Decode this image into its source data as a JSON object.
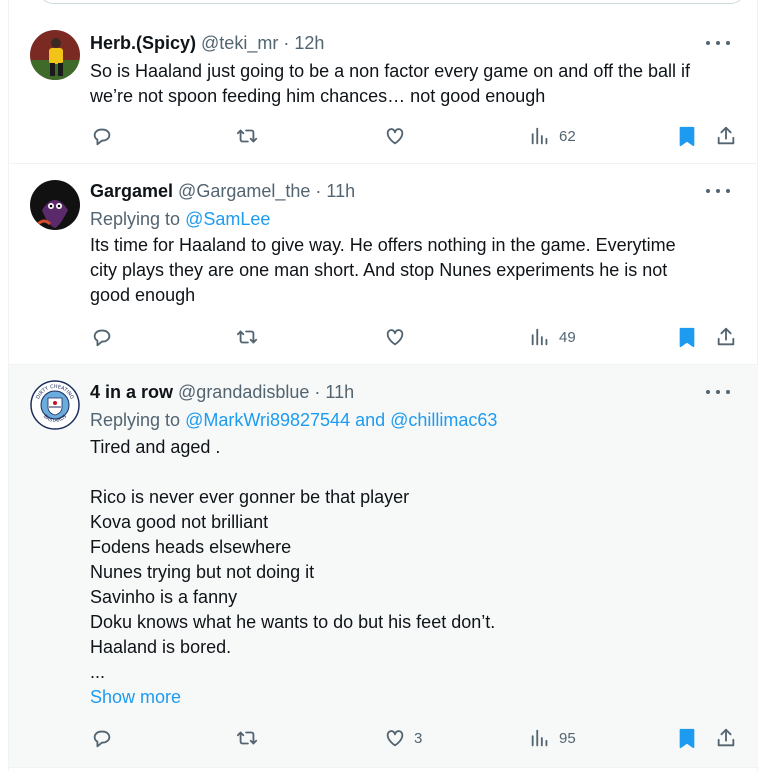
{
  "tweets": [
    {
      "name": "Herb.(Spicy)",
      "handle": "@teki_mr",
      "dot": "·",
      "time": "12h",
      "text_lines": [
        "So is Haaland just going to be a non factor every game on and off the ball if",
        "we’re not spoon feeding him chances… not good enough"
      ],
      "likes": "",
      "views": "62"
    },
    {
      "name": "Gargamel",
      "handle": "@Gargamel_the",
      "dot": "·",
      "time": "11h",
      "replying_prefix": "Replying to ",
      "replying_to": "@SamLee",
      "text_lines": [
        "Its time for Haaland to give way. He offers nothing in the game. Everytime",
        "city plays they are one man short. And stop Nunes experiments he is not",
        "good enough"
      ],
      "likes": "",
      "views": "49"
    },
    {
      "name": "4 in a row",
      "handle": "@grandadisblue",
      "dot": "·",
      "time": "11h",
      "replying_prefix": "Replying to ",
      "replying_to": "@MarkWri89827544 and @chillimac63",
      "text_lines": [
        "Tired and aged .",
        "",
        "Rico is never ever gonner be that player",
        "Kova good not brilliant",
        "Fodens heads elsewhere",
        "Nunes trying but not doing it",
        "Savinho is a fanny",
        "Doku knows what he wants to do but his feet don’t.",
        "Haaland is bored.",
        "..."
      ],
      "show_more": "Show more",
      "likes": "3",
      "views": "95",
      "avatar_text_top": "DIRTY CHEATING",
      "avatar_text_bottom": "BASTARDS"
    }
  ],
  "icons": {
    "reply": "reply-icon",
    "retweet": "retweet-icon",
    "like": "heart-icon",
    "views": "views-icon",
    "bookmark": "bookmark-icon",
    "share": "share-icon",
    "more": "more-icon"
  },
  "colors": {
    "accent": "#1d9bf0",
    "muted": "#536471",
    "text": "#0f1419",
    "highlight_bg": "#f7f9f9"
  }
}
